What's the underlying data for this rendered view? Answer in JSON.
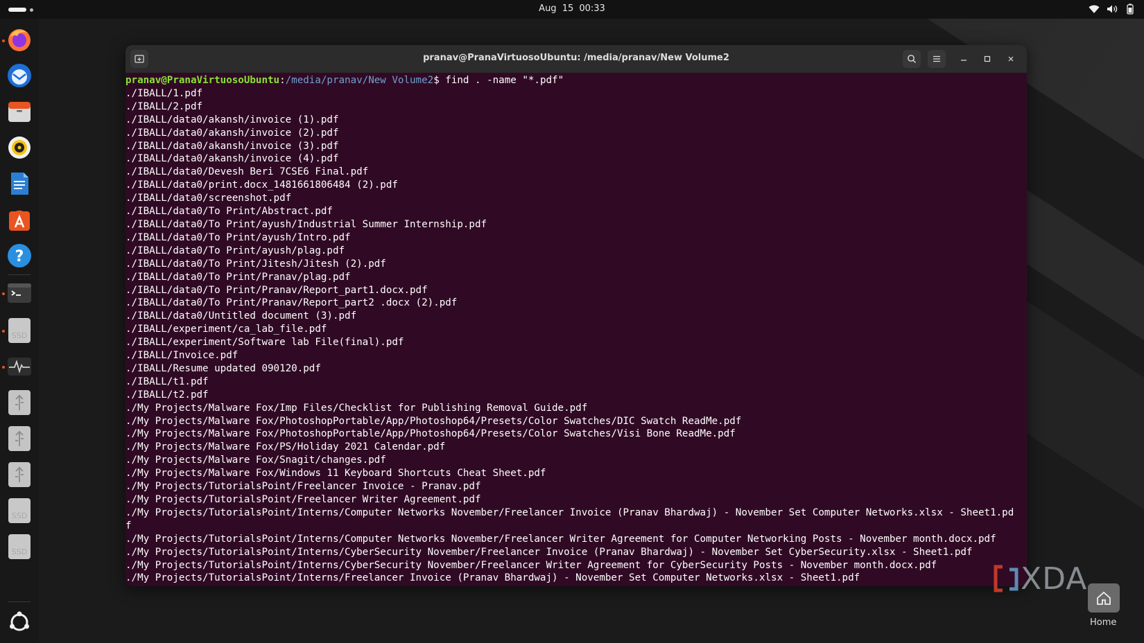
{
  "topbar": {
    "clock": "Aug 15  00:33",
    "icons": [
      "wifi-icon",
      "volume-icon",
      "battery-icon"
    ]
  },
  "dock": {
    "items": [
      "firefox",
      "thunderbird",
      "files",
      "rhythmbox",
      "libreoffice-writer",
      "app-center",
      "help",
      "terminal",
      "ssd-drive",
      "system-monitor",
      "usb-drive",
      "usb-drive",
      "usb-drive",
      "ssd-drive",
      "ssd-drive",
      "show-apps"
    ],
    "ssd_label": "SSD"
  },
  "window": {
    "title": "pranav@PranaVirtuosoUbuntu: /media/pranav/New Volume2"
  },
  "terminal": {
    "prompt_user": "pranav@PranaVirtuosoUbuntu",
    "prompt_sep": ":",
    "prompt_path": "/media/pranav/New Volume2",
    "prompt_end": "$ ",
    "command": "find . -name \"*.pdf\"",
    "output": [
      "./IBALL/1.pdf",
      "./IBALL/2.pdf",
      "./IBALL/data0/akansh/invoice (1).pdf",
      "./IBALL/data0/akansh/invoice (2).pdf",
      "./IBALL/data0/akansh/invoice (3).pdf",
      "./IBALL/data0/akansh/invoice (4).pdf",
      "./IBALL/data0/Devesh Beri 7CSE6 Final.pdf",
      "./IBALL/data0/print.docx_1481661806484 (2).pdf",
      "./IBALL/data0/screenshot.pdf",
      "./IBALL/data0/To Print/Abstract.pdf",
      "./IBALL/data0/To Print/ayush/Industrial Summer Internship.pdf",
      "./IBALL/data0/To Print/ayush/Intro.pdf",
      "./IBALL/data0/To Print/ayush/plag.pdf",
      "./IBALL/data0/To Print/Jitesh/Jitesh (2).pdf",
      "./IBALL/data0/To Print/Pranav/plag.pdf",
      "./IBALL/data0/To Print/Pranav/Report_part1.docx.pdf",
      "./IBALL/data0/To Print/Pranav/Report_part2 .docx (2).pdf",
      "./IBALL/data0/Untitled document (3).pdf",
      "./IBALL/experiment/ca_lab_file.pdf",
      "./IBALL/experiment/Software lab File(final).pdf",
      "./IBALL/Invoice.pdf",
      "./IBALL/Resume updated 090120.pdf",
      "./IBALL/t1.pdf",
      "./IBALL/t2.pdf",
      "./My Projects/Malware Fox/Imp Files/Checklist for Publishing Removal Guide.pdf",
      "./My Projects/Malware Fox/PhotoshopPortable/App/Photoshop64/Presets/Color Swatches/DIC Swatch ReadMe.pdf",
      "./My Projects/Malware Fox/PhotoshopPortable/App/Photoshop64/Presets/Color Swatches/Visi Bone ReadMe.pdf",
      "./My Projects/Malware Fox/PS/Holiday 2021 Calendar.pdf",
      "./My Projects/Malware Fox/Snagit/changes.pdf",
      "./My Projects/Malware Fox/Windows 11 Keyboard Shortcuts Cheat Sheet.pdf",
      "./My Projects/TutorialsPoint/Freelancer Invoice - Pranav.pdf",
      "./My Projects/TutorialsPoint/Freelancer Writer Agreement.pdf",
      "./My Projects/TutorialsPoint/Interns/Computer Networks November/Freelancer Invoice (Pranav Bhardwaj) - November Set Computer Networks.xlsx - Sheet1.pd",
      "f",
      "./My Projects/TutorialsPoint/Interns/Computer Networks November/Freelancer Writer Agreement for Computer Networking Posts - November month.docx.pdf",
      "./My Projects/TutorialsPoint/Interns/CyberSecurity November/Freelancer Invoice (Pranav Bhardwaj) - November Set CyberSecurity.xlsx - Sheet1.pdf",
      "./My Projects/TutorialsPoint/Interns/CyberSecurity November/Freelancer Writer Agreement for CyberSecurity Posts - November month.docx.pdf",
      "./My Projects/TutorialsPoint/Interns/Freelancer Invoice (Pranav Bhardwaj) - November Set Computer Networks.xlsx - Sheet1.pdf"
    ]
  },
  "watermark": {
    "brand": "XDA",
    "home_label": "Home"
  }
}
